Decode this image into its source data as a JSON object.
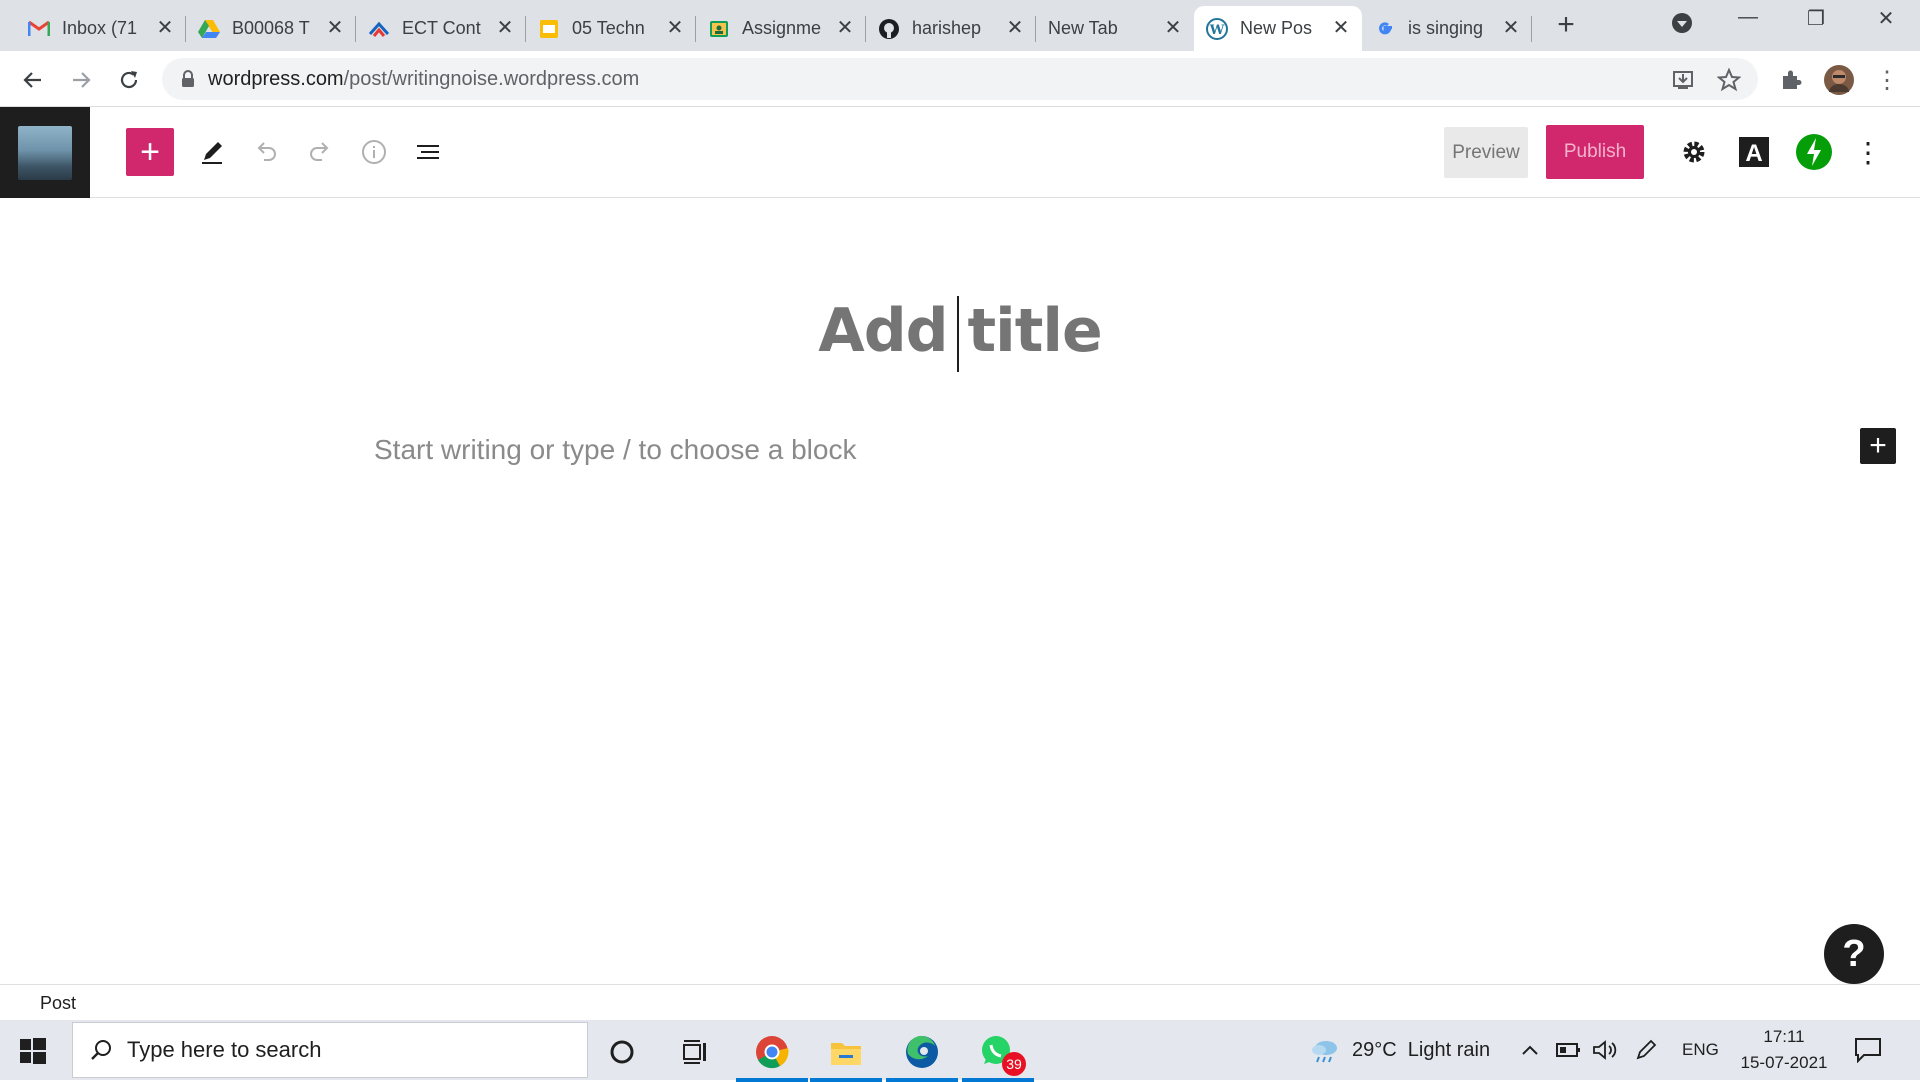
{
  "browser": {
    "tabs": [
      {
        "title": "Inbox (71",
        "icon": "gmail-icon",
        "active": false
      },
      {
        "title": "B00068 T",
        "icon": "google-drive-icon",
        "active": false
      },
      {
        "title": "ECT Cont",
        "icon": "ect-icon",
        "active": false
      },
      {
        "title": "05 Techn",
        "icon": "google-slides-icon",
        "active": false
      },
      {
        "title": "Assignme",
        "icon": "google-classroom-icon",
        "active": false
      },
      {
        "title": "harishep",
        "icon": "github-icon",
        "active": false
      },
      {
        "title": "New Tab",
        "icon": "",
        "active": false
      },
      {
        "title": "New Pos",
        "icon": "wordpress-icon",
        "active": true
      },
      {
        "title": "is singing",
        "icon": "google-icon",
        "active": false
      }
    ],
    "url_domain": "wordpress.com",
    "url_path": "/post/writingnoise.wordpress.com"
  },
  "editor": {
    "preview_label": "Preview",
    "publish_label": "Publish",
    "title_placeholder": "Add title",
    "block_placeholder": "Start writing or type / to choose a block",
    "footer_breadcrumb": "Post",
    "help_label": "?"
  },
  "taskbar": {
    "search_placeholder": "Type here to search",
    "weather": "29°C  Light rain",
    "language": "ENG",
    "time": "17:11",
    "date": "15-07-2021",
    "whatsapp_badge": "39"
  },
  "colors": {
    "accent": "#d1286d",
    "editor_dark": "#1e1e1e",
    "jetpack_green": "#069e08"
  }
}
